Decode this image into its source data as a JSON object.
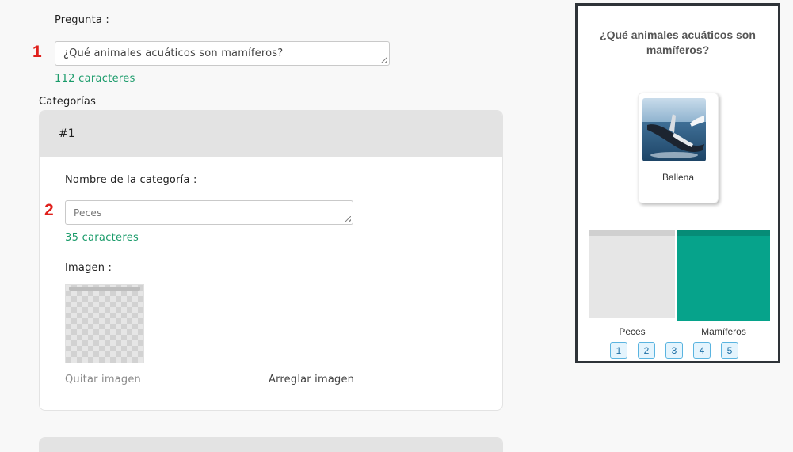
{
  "editor": {
    "question_label": "Pregunta :",
    "question_step": "1",
    "question_value": "¿Qué animales acuáticos son mamíferos?",
    "question_counter": "112 caracteres",
    "categories_label": "Categorías",
    "category_card": {
      "title": "#1",
      "name_label": "Nombre de la categoría :",
      "name_step": "2",
      "name_placeholder": "Peces",
      "name_counter": "35 caracteres",
      "image_label": "Imagen :",
      "remove_image": "Quitar imagen",
      "fix_image": "Arreglar imagen"
    }
  },
  "preview": {
    "question": "¿Qué animales acuáticos son mamíferos?",
    "item": {
      "label": "Ballena",
      "image_icon": "whale-photo"
    },
    "bins": [
      {
        "label": "Peces",
        "color": "#e6e6e6",
        "border_color": "#d0d0d0"
      },
      {
        "label": "Mamíferos",
        "color": "#06a38b",
        "border_color": "#068c77"
      }
    ],
    "pages": [
      "1",
      "2",
      "3",
      "4",
      "5"
    ]
  }
}
